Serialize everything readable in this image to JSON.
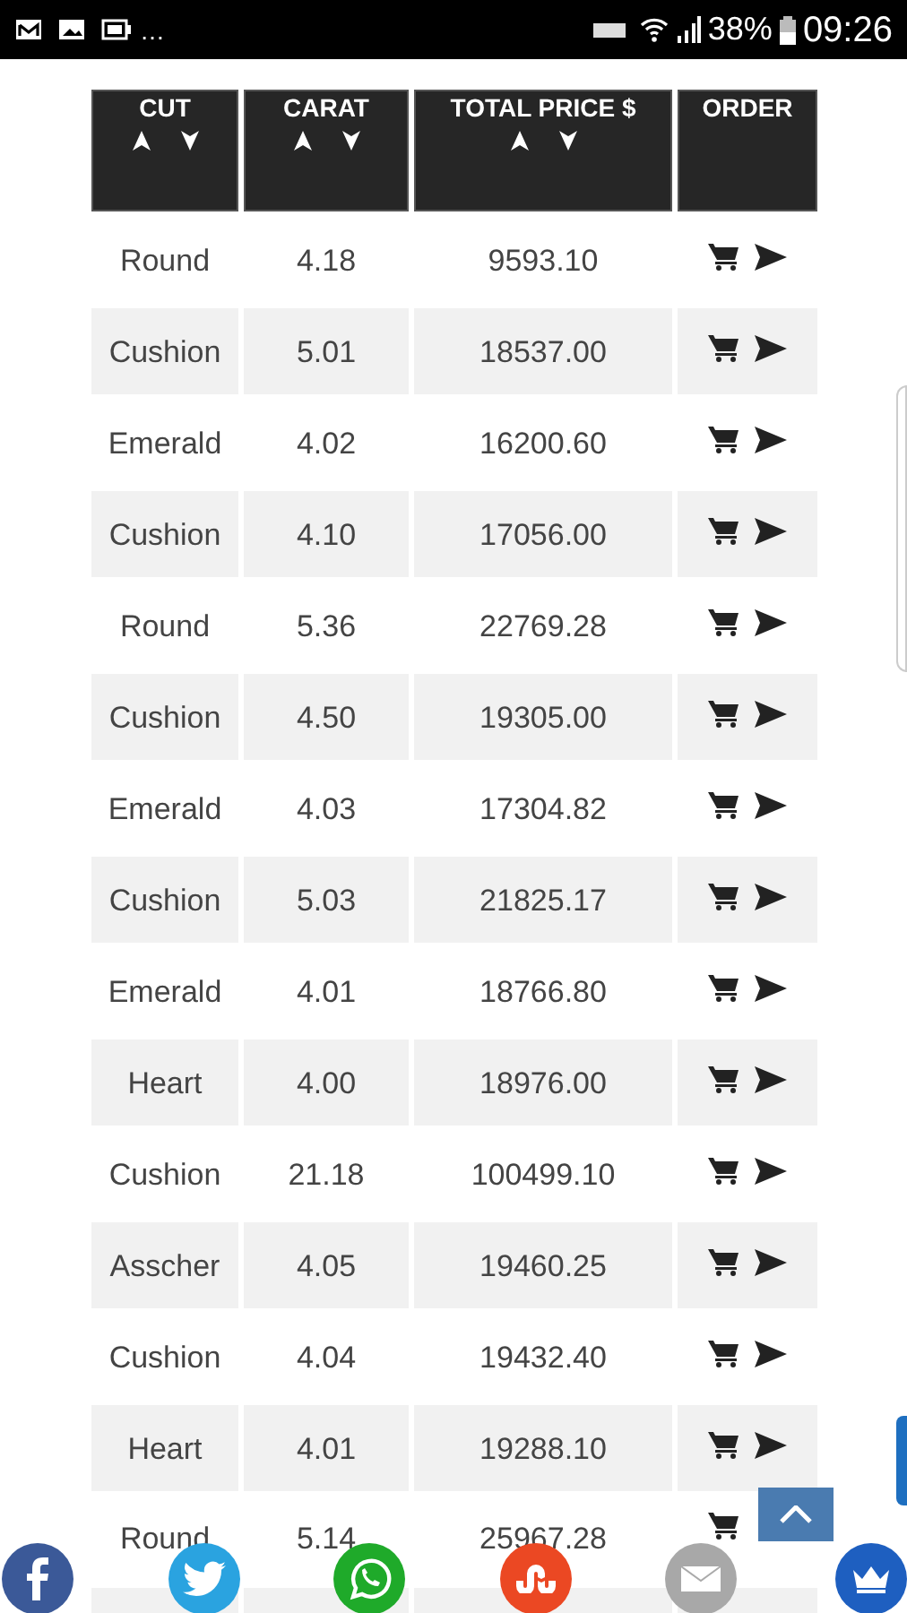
{
  "status_bar": {
    "notifications": "…",
    "battery_percent": "38%",
    "time": "09:26"
  },
  "table": {
    "columns": [
      {
        "label": "CUT",
        "sortable": true
      },
      {
        "label": "CARAT",
        "sortable": true
      },
      {
        "label": "TOTAL PRICE $",
        "sortable": true
      },
      {
        "label": "ORDER",
        "sortable": false
      }
    ],
    "rows": [
      {
        "cut": "Round",
        "carat": "4.18",
        "price": "9593.10"
      },
      {
        "cut": "Cushion",
        "carat": "5.01",
        "price": "18537.00"
      },
      {
        "cut": "Emerald",
        "carat": "4.02",
        "price": "16200.60"
      },
      {
        "cut": "Cushion",
        "carat": "4.10",
        "price": "17056.00"
      },
      {
        "cut": "Round",
        "carat": "5.36",
        "price": "22769.28"
      },
      {
        "cut": "Cushion",
        "carat": "4.50",
        "price": "19305.00"
      },
      {
        "cut": "Emerald",
        "carat": "4.03",
        "price": "17304.82"
      },
      {
        "cut": "Cushion",
        "carat": "5.03",
        "price": "21825.17"
      },
      {
        "cut": "Emerald",
        "carat": "4.01",
        "price": "18766.80"
      },
      {
        "cut": "Heart",
        "carat": "4.00",
        "price": "18976.00"
      },
      {
        "cut": "Cushion",
        "carat": "21.18",
        "price": "100499.10"
      },
      {
        "cut": "Asscher",
        "carat": "4.05",
        "price": "19460.25"
      },
      {
        "cut": "Cushion",
        "carat": "4.04",
        "price": "19432.40"
      },
      {
        "cut": "Heart",
        "carat": "4.01",
        "price": "19288.10"
      },
      {
        "cut": "Round",
        "carat": "5.14",
        "price": "25967.28"
      }
    ]
  }
}
